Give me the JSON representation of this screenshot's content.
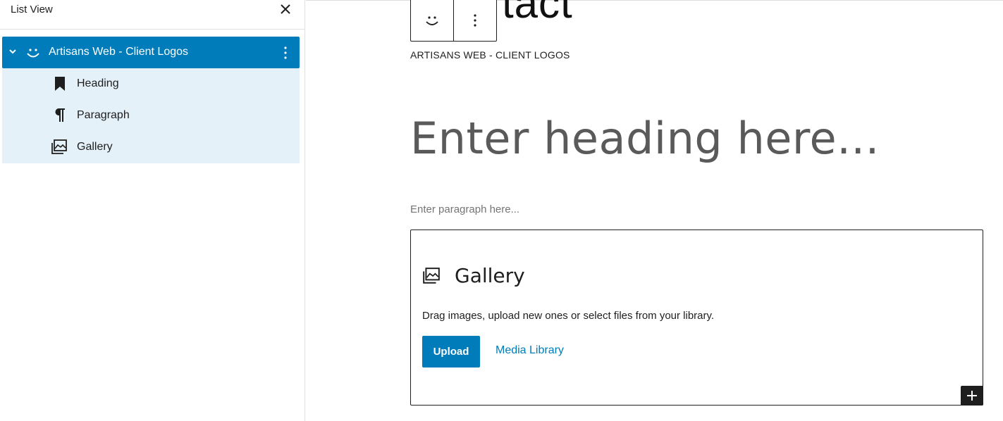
{
  "sidebar": {
    "title": "List View",
    "close_icon": "close-icon",
    "items": [
      {
        "label": "Artisans Web - Client Logos",
        "icon": "smiley-block-icon",
        "selected": true,
        "expanded": true
      },
      {
        "label": "Heading",
        "icon": "bookmark-heading-icon"
      },
      {
        "label": "Paragraph",
        "icon": "pilcrow-paragraph-icon"
      },
      {
        "label": "Gallery",
        "icon": "gallery-icon"
      }
    ]
  },
  "canvas": {
    "page_title_fragment": "tact",
    "block_name": "ARTISANS WEB - CLIENT LOGOS",
    "heading_placeholder": "Enter heading here...",
    "paragraph_placeholder": "Enter paragraph here...",
    "gallery": {
      "title": "Gallery",
      "instructions": "Drag images, upload new ones or select files from your library.",
      "upload_label": "Upload",
      "media_library_label": "Media Library"
    }
  },
  "colors": {
    "accent": "#007cba",
    "selected_row_bg": "#007cba",
    "child_row_bg": "#e5f1f8",
    "text": "#1e1e1e",
    "placeholder_heading": "#5a5a5a",
    "placeholder_para": "#757575"
  }
}
